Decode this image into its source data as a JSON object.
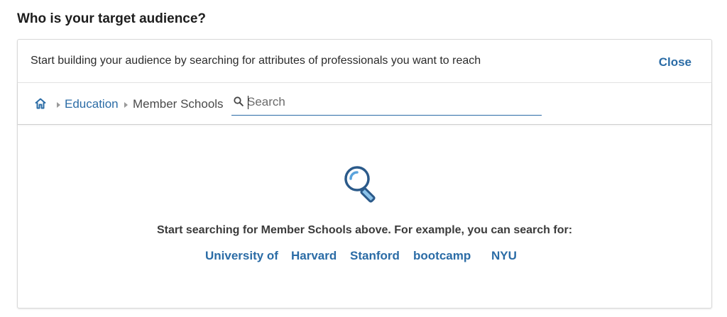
{
  "heading": "Who is your target audience?",
  "panel": {
    "description": "Start building your audience by searching for attributes of professionals you want to reach",
    "close_label": "Close"
  },
  "breadcrumb": {
    "home_icon": "home-icon",
    "items": [
      {
        "label": "Education",
        "link": true
      },
      {
        "label": "Member Schools",
        "link": false
      }
    ]
  },
  "search": {
    "placeholder": "Search",
    "value": ""
  },
  "empty_state": {
    "icon": "magnifying-glass-icon",
    "text": "Start searching for Member Schools above. For example, you can search for:",
    "suggestions": [
      "University of",
      "Harvard",
      "Stanford",
      "bootcamp",
      "NYU"
    ]
  },
  "colors": {
    "link": "#2b6ca6",
    "icon_blue": "#2b6ca6",
    "border": "#d9d9d9"
  }
}
